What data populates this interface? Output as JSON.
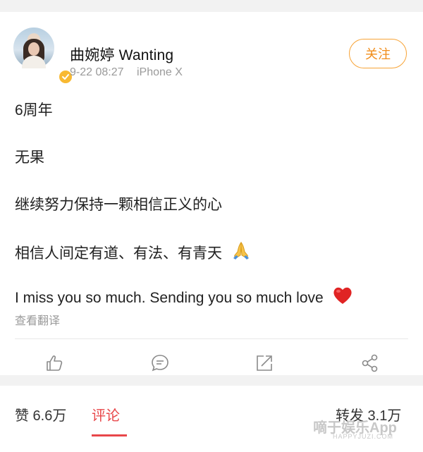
{
  "header": {
    "username": "曲婉婷 Wanting",
    "timestamp": "9-22 08:27",
    "device": "iPhone X",
    "follow_label": "关注"
  },
  "post": {
    "lines": [
      "6周年",
      "无果",
      "继续努力保持一颗相信正义的心",
      "相信人间定有道、有法、有青天",
      "I miss you so much. Sending you so much love"
    ],
    "translate_label": "查看翻译",
    "emoji_line4": "folded-hands-emoji",
    "emoji_line5": "red-heart-emoji"
  },
  "actions": {
    "icons": [
      "thumbs-up-icon",
      "comment-icon",
      "repost-icon",
      "share-icon"
    ]
  },
  "stats": {
    "likes": "赞 6.6万",
    "comments_tab": "评论",
    "reposts": "转发 3.1万"
  },
  "watermark": {
    "text": "嘀于娱乐App",
    "subtext": "HAPPYJUZI.COM"
  },
  "colors": {
    "accent_orange": "#f18d1a",
    "comment_red": "#e8474a",
    "verified_yellow": "#f8b932"
  }
}
